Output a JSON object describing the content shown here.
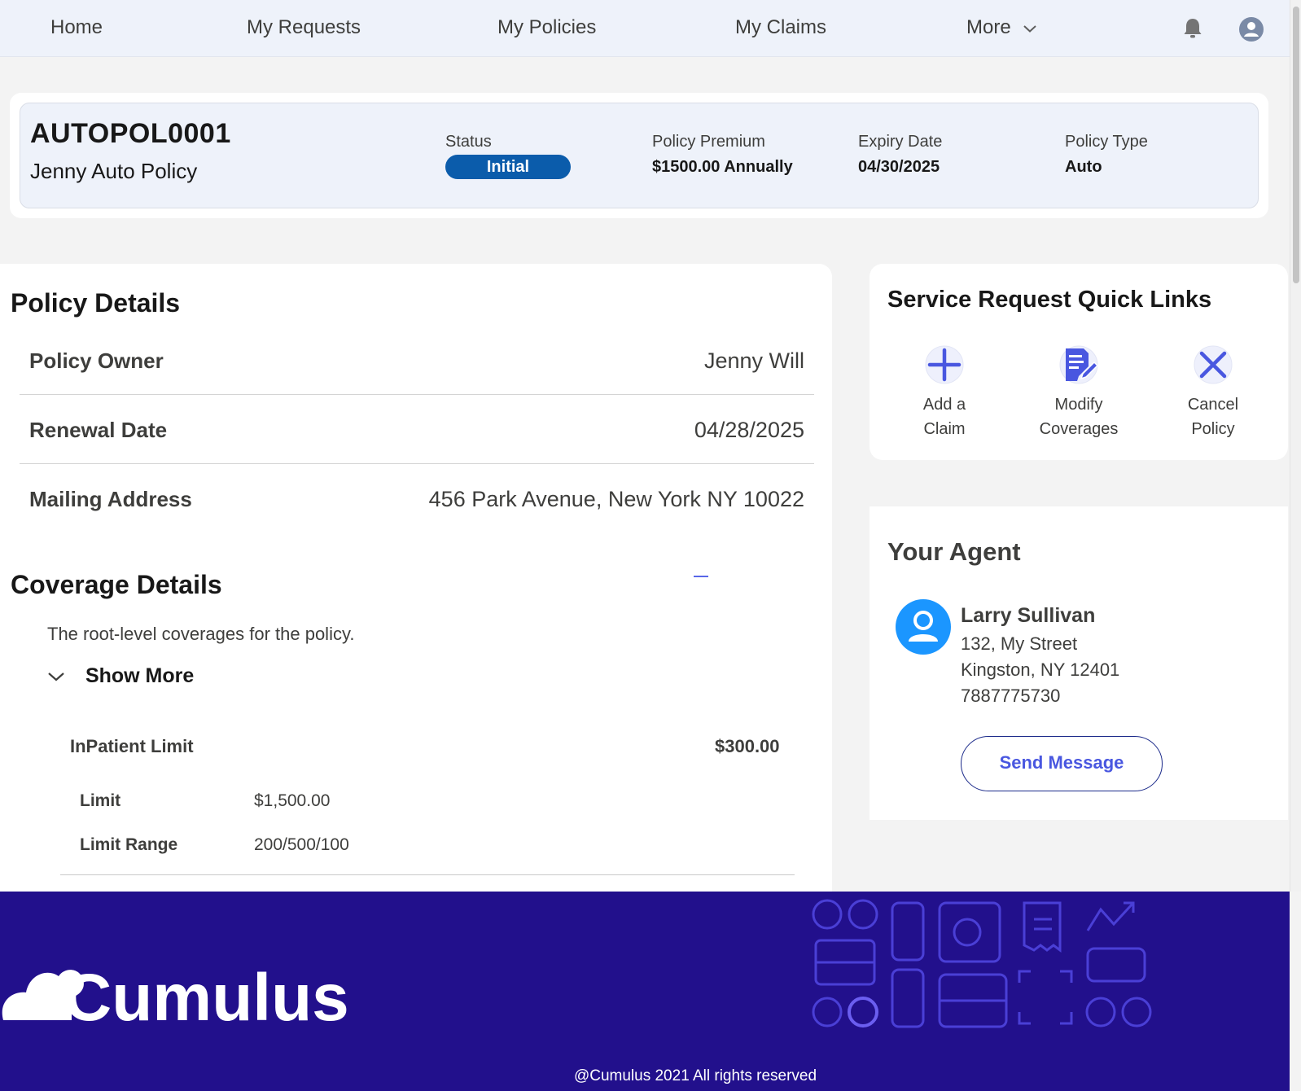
{
  "nav": {
    "items": [
      "Home",
      "My Requests",
      "My Policies",
      "My Claims"
    ],
    "more_label": "More",
    "icons": [
      "bell-icon",
      "user-avatar-icon",
      "chevron-down-icon"
    ]
  },
  "highlights": {
    "policy_id": "AUTOPOL0001",
    "policy_name": "Jenny Auto Policy",
    "status_label": "Status",
    "status_value": "Initial",
    "premium_label": "Policy Premium",
    "premium_value": "$1500.00 Annually",
    "expiry_label": "Expiry Date",
    "expiry_value": "04/30/2025",
    "type_label": "Policy Type",
    "type_value": "Auto"
  },
  "policy_details": {
    "title": "Policy Details",
    "rows": [
      {
        "label": "Policy Owner",
        "value": "Jenny Will"
      },
      {
        "label": "Renewal Date",
        "value": "04/28/2025"
      },
      {
        "label": "Mailing Address",
        "value": "456 Park Avenue, New York NY 10022"
      }
    ]
  },
  "coverage": {
    "title": "Coverage Details",
    "description": "The root-level coverages for the policy.",
    "show_more_label": "Show More",
    "item": {
      "name": "InPatient Limit",
      "amount": "$300.00",
      "attributes": [
        {
          "label": "Limit",
          "value": "$1,500.00"
        },
        {
          "label": "Limit Range",
          "value": "200/500/100"
        }
      ]
    }
  },
  "quick_links": {
    "title": "Service Request Quick Links",
    "items": [
      {
        "line1": "Add a",
        "line2": "Claim",
        "icon": "plus-icon"
      },
      {
        "line1": "Modify",
        "line2": "Coverages",
        "icon": "edit-document-icon"
      },
      {
        "line1": "Cancel",
        "line2": "Policy",
        "icon": "close-icon"
      }
    ]
  },
  "agent": {
    "title": "Your Agent",
    "name": "Larry Sullivan",
    "address1": "132, My Street",
    "address2": "Kingston, NY 12401",
    "phone": "7887775730",
    "button_label": "Send Message"
  },
  "footer": {
    "brand": "Cumulus",
    "copyright": "@Cumulus 2021 All rights reserved"
  },
  "colors": {
    "nav_bg": "#eef2fa",
    "status_pill": "#0b5cab",
    "accent": "#4957e0",
    "footer_bg": "#22108c"
  }
}
